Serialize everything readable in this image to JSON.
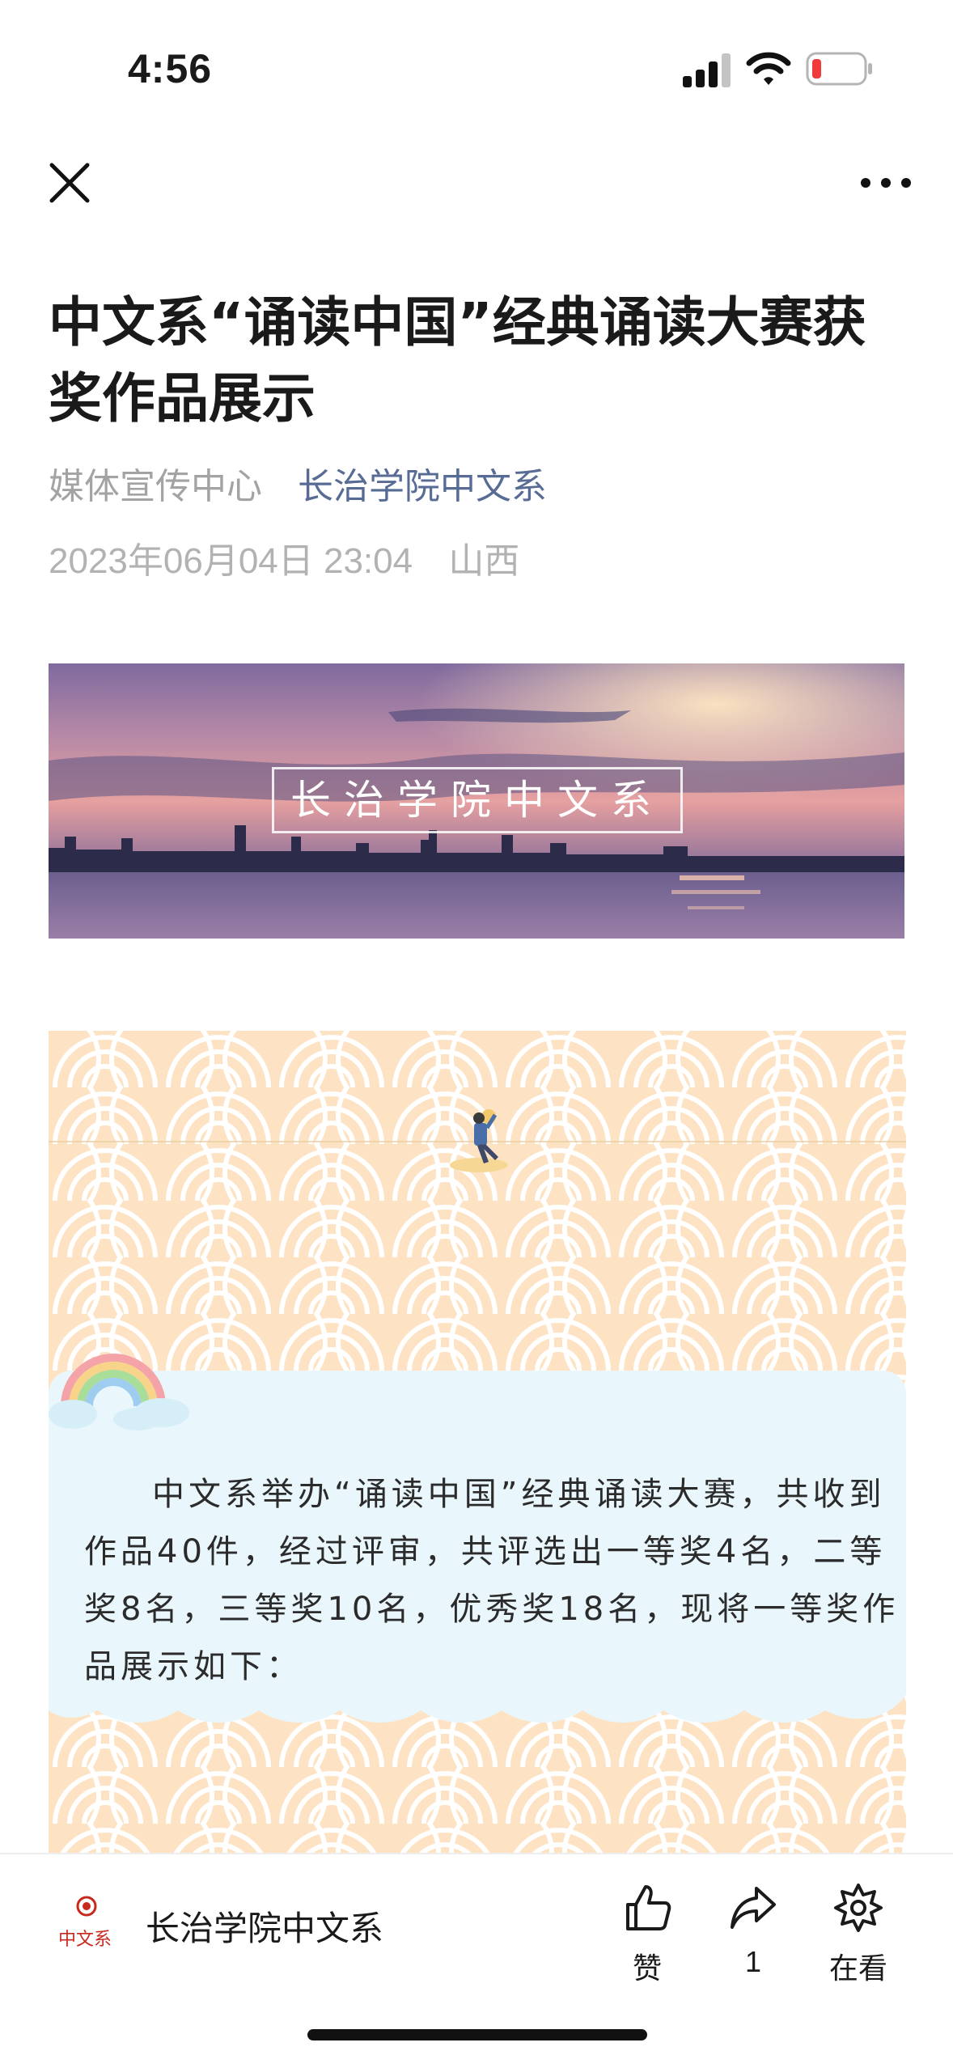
{
  "status_bar": {
    "time": "4:56"
  },
  "nav": {
    "close_icon": "close-icon",
    "more_icon": "more-icon"
  },
  "article": {
    "title": "中文系“诵读中国”经典诵读大赛获奖作品展示",
    "author": "媒体宣传中心",
    "account": "长治学院中文系",
    "date": "2023年06月04日 23:04",
    "location": "山西"
  },
  "banner": {
    "label": "长治学院中文系"
  },
  "poster": {
    "body": "中文系举办“诵读中国”经典诵读大赛，共收到作品40件，经过评审，共评选出一等奖4名，二等奖8名，三等奖10名，优秀奖18名，现将一等奖作品展示如下："
  },
  "bottom_bar": {
    "account_name": "长治学院中文系",
    "actions": [
      {
        "icon": "thumbs-up-icon",
        "label": "赞"
      },
      {
        "icon": "share-icon",
        "label": "1"
      },
      {
        "icon": "watching-icon",
        "label": "在看"
      }
    ]
  },
  "colors": {
    "account_link": "#576b95",
    "meta_gray": "#a3a3a3",
    "poster_peach": "#fde3c4",
    "card_blue": "#e9f6fb",
    "logo_red": "#c8281e"
  }
}
